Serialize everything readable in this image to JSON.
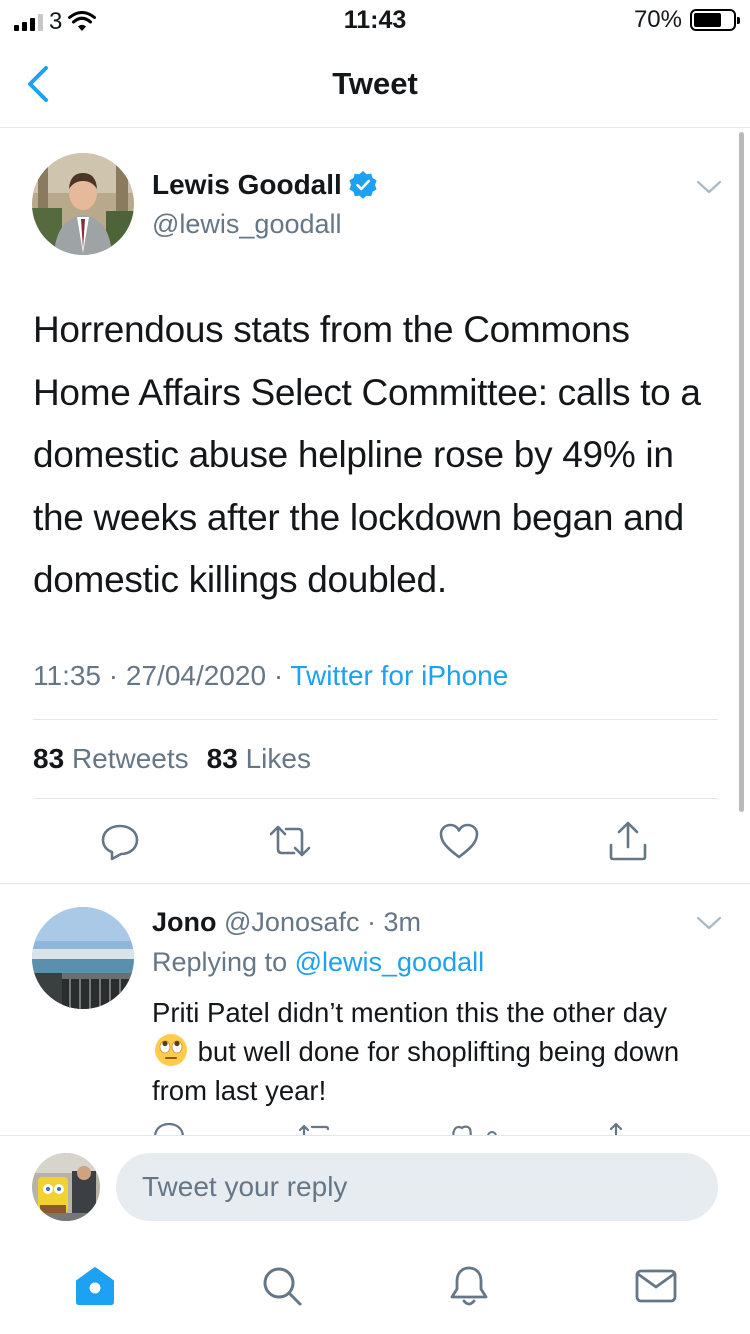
{
  "status_bar": {
    "carrier": "3",
    "time": "11:43",
    "battery_percent": "70%",
    "battery_level": 0.7
  },
  "nav": {
    "title": "Tweet",
    "back_icon": "chevron-left-icon"
  },
  "tweet": {
    "author_name": "Lewis Goodall",
    "author_handle": "@lewis_goodall",
    "verified": true,
    "text": "Horrendous stats from the Commons Home Affairs Select Committee: calls to a domestic abuse helpline rose by 49% in the weeks after the lockdown began and domestic killings doubled.",
    "time": "11:35",
    "date": "27/04/2020",
    "separator": "·",
    "source": "Twitter for iPhone",
    "retweets_count": "83",
    "retweets_label": "Retweets",
    "likes_count": "83",
    "likes_label": "Likes",
    "actions": [
      "reply-icon",
      "retweet-icon",
      "like-icon",
      "share-icon"
    ]
  },
  "reply": {
    "author_name": "Jono",
    "author_handle": "@Jonosafc",
    "separator": "·",
    "age": "3m",
    "replying_prefix": "Replying to",
    "replying_to": "@lewis_goodall",
    "text_before_emoji": "Priti Patel didn’t mention this the other day",
    "emoji": "face-with-rolling-eyes",
    "text_after_emoji": "but well done for shoplifting being down from last year!"
  },
  "compose": {
    "placeholder": "Tweet your reply"
  },
  "tab_bar": {
    "tabs": [
      "home-icon",
      "search-icon",
      "notifications-icon",
      "messages-icon"
    ],
    "active": "home-icon"
  },
  "colors": {
    "accent": "#1da1f2",
    "secondary_text": "#657786",
    "primary_text": "#14171a",
    "divider": "#e1e8ed",
    "reply_box": "#e6ecf0"
  }
}
